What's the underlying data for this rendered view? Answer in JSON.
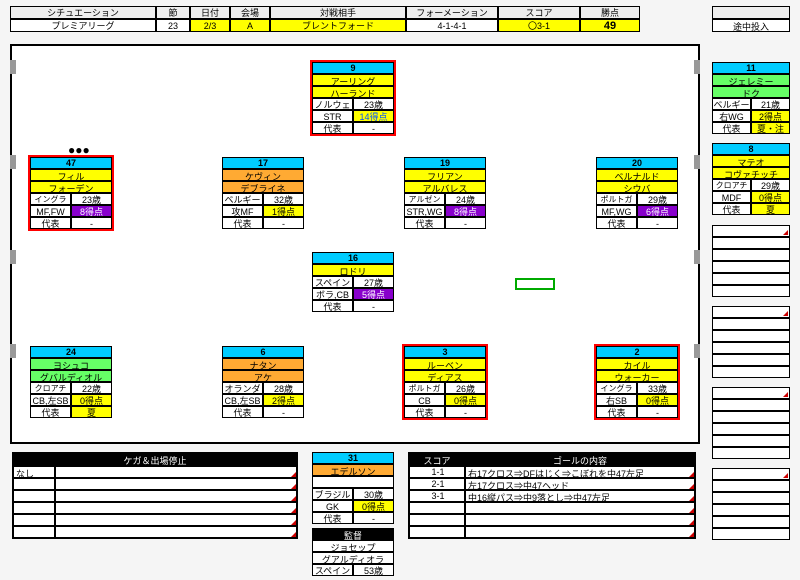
{
  "header": {
    "labels": {
      "situation": "シチュエーション",
      "sec": "節",
      "date": "日付",
      "venue": "会場",
      "opponent": "対戦相手",
      "formation": "フォーメーション",
      "score": "スコア",
      "points": "勝点"
    },
    "values": {
      "situation": "プレミアリーグ",
      "sec": "23",
      "date": "2/3",
      "venue": "A",
      "opponent": "ブレントフォード",
      "formation": "4-1-4-1",
      "score": "〇3-1",
      "points": "49"
    }
  },
  "side_header": "途中投入",
  "players": {
    "p9": {
      "num": "9",
      "name1": "アーリング",
      "name2": "ハーランド",
      "nat": "ノルウェー",
      "age": "23歳",
      "pos": "STR",
      "gk": "14得点",
      "rep": "代表",
      "repv": "-",
      "col": "yel",
      "outline": true
    },
    "p47": {
      "num": "47",
      "name1": "フィル",
      "name2": "フォーデン",
      "nat": "イングランド",
      "age": "23歳",
      "pos": "MF,FW",
      "gk": "8得点",
      "rep": "代表",
      "repv": "-",
      "col": "yel",
      "outline": true,
      "gkpur": true
    },
    "p17": {
      "num": "17",
      "name1": "ケヴィン",
      "name2": "デブライネ",
      "nat": "ベルギー",
      "age": "32歳",
      "pos": "攻MF",
      "gk": "1得点",
      "rep": "代表",
      "repv": "-",
      "col": "or"
    },
    "p19": {
      "num": "19",
      "name1": "フリアン",
      "name2": "アルバレス",
      "nat": "アルゼンチン",
      "age": "24歳",
      "pos": "STR,WG",
      "gk": "8得点",
      "rep": "代表",
      "repv": "-",
      "col": "yel",
      "gkpur": true
    },
    "p20": {
      "num": "20",
      "name1": "ベルナルド",
      "name2": "シウバ",
      "nat": "ポルトガル",
      "age": "29歳",
      "pos": "MF,WG",
      "gk": "6得点",
      "rep": "代表",
      "repv": "-",
      "col": "yel",
      "gkpur": true
    },
    "p16": {
      "num": "16",
      "name1": "",
      "name2": "ロドリ",
      "nat": "スペイン",
      "age": "27歳",
      "pos": "ボラ,CB",
      "gk": "5得点",
      "rep": "代表",
      "repv": "-",
      "col": "yel",
      "gkpur": true
    },
    "p24": {
      "num": "24",
      "name1": "ヨシュコ",
      "name2": "グバルディオル",
      "nat": "クロアチア",
      "age": "22歳",
      "pos": "CB,左SB",
      "gk": "0得点",
      "rep": "代表",
      "repv": "夏",
      "col": "grn"
    },
    "p6": {
      "num": "6",
      "name1": "ナタン",
      "name2": "アケ",
      "nat": "オランダ",
      "age": "28歳",
      "pos": "CB,左SB",
      "gk": "2得点",
      "rep": "代表",
      "repv": "-",
      "col": "or"
    },
    "p3": {
      "num": "3",
      "name1": "ルーベン",
      "name2": "ディアス",
      "nat": "ポルトガル",
      "age": "26歳",
      "pos": "CB",
      "gk": "0得点",
      "rep": "代表",
      "repv": "-",
      "col": "yel",
      "outline": true
    },
    "p2": {
      "num": "2",
      "name1": "カイル",
      "name2": "ウォーカー",
      "nat": "イングランド",
      "age": "33歳",
      "pos": "右SB",
      "gk": "0得点",
      "rep": "代表",
      "repv": "-",
      "col": "yel",
      "outline": true
    },
    "p31": {
      "num": "31",
      "name1": "",
      "name2": "エデルソン",
      "nat": "ブラジル",
      "age": "30歳",
      "pos": "GK",
      "gk": "0得点",
      "rep": "代表",
      "repv": "-",
      "col": "or"
    },
    "p11": {
      "num": "11",
      "name1": "ジェレミー",
      "name2": "ドク",
      "nat": "ベルギー",
      "age": "21歳",
      "pos": "右WG",
      "gk": "2得点",
      "rep": "代表",
      "repv": "夏・注",
      "col": "grn"
    },
    "p8": {
      "num": "8",
      "name1": "マテオ",
      "name2": "コヴァチッチ",
      "nat": "クロアチア",
      "age": "29歳",
      "pos": "MDF",
      "gk": "0得点",
      "rep": "代表",
      "repv": "夏",
      "col": "yel"
    }
  },
  "manager": {
    "title": "監督",
    "name1": "ジョセップ",
    "name2": "グアルディオラ",
    "nat": "スペイン",
    "age": "53歳"
  },
  "injury": {
    "header": "ケガ＆出場停止",
    "rows": [
      "なし",
      "",
      "",
      "",
      "",
      ""
    ]
  },
  "goals": {
    "hdr": {
      "score": "スコア",
      "desc": "ゴールの内容"
    },
    "rows": [
      {
        "s": "1-1",
        "d": "右17クロス⇒DFはじく⇒こぼれを中47左足"
      },
      {
        "s": "2-1",
        "d": "左17クロス⇒中47ヘッド"
      },
      {
        "s": "3-1",
        "d": "中16縦パス⇒中9落とし⇒中47左足"
      },
      {
        "s": "",
        "d": ""
      },
      {
        "s": "",
        "d": ""
      },
      {
        "s": "",
        "d": ""
      }
    ]
  },
  "dots": "●●●"
}
